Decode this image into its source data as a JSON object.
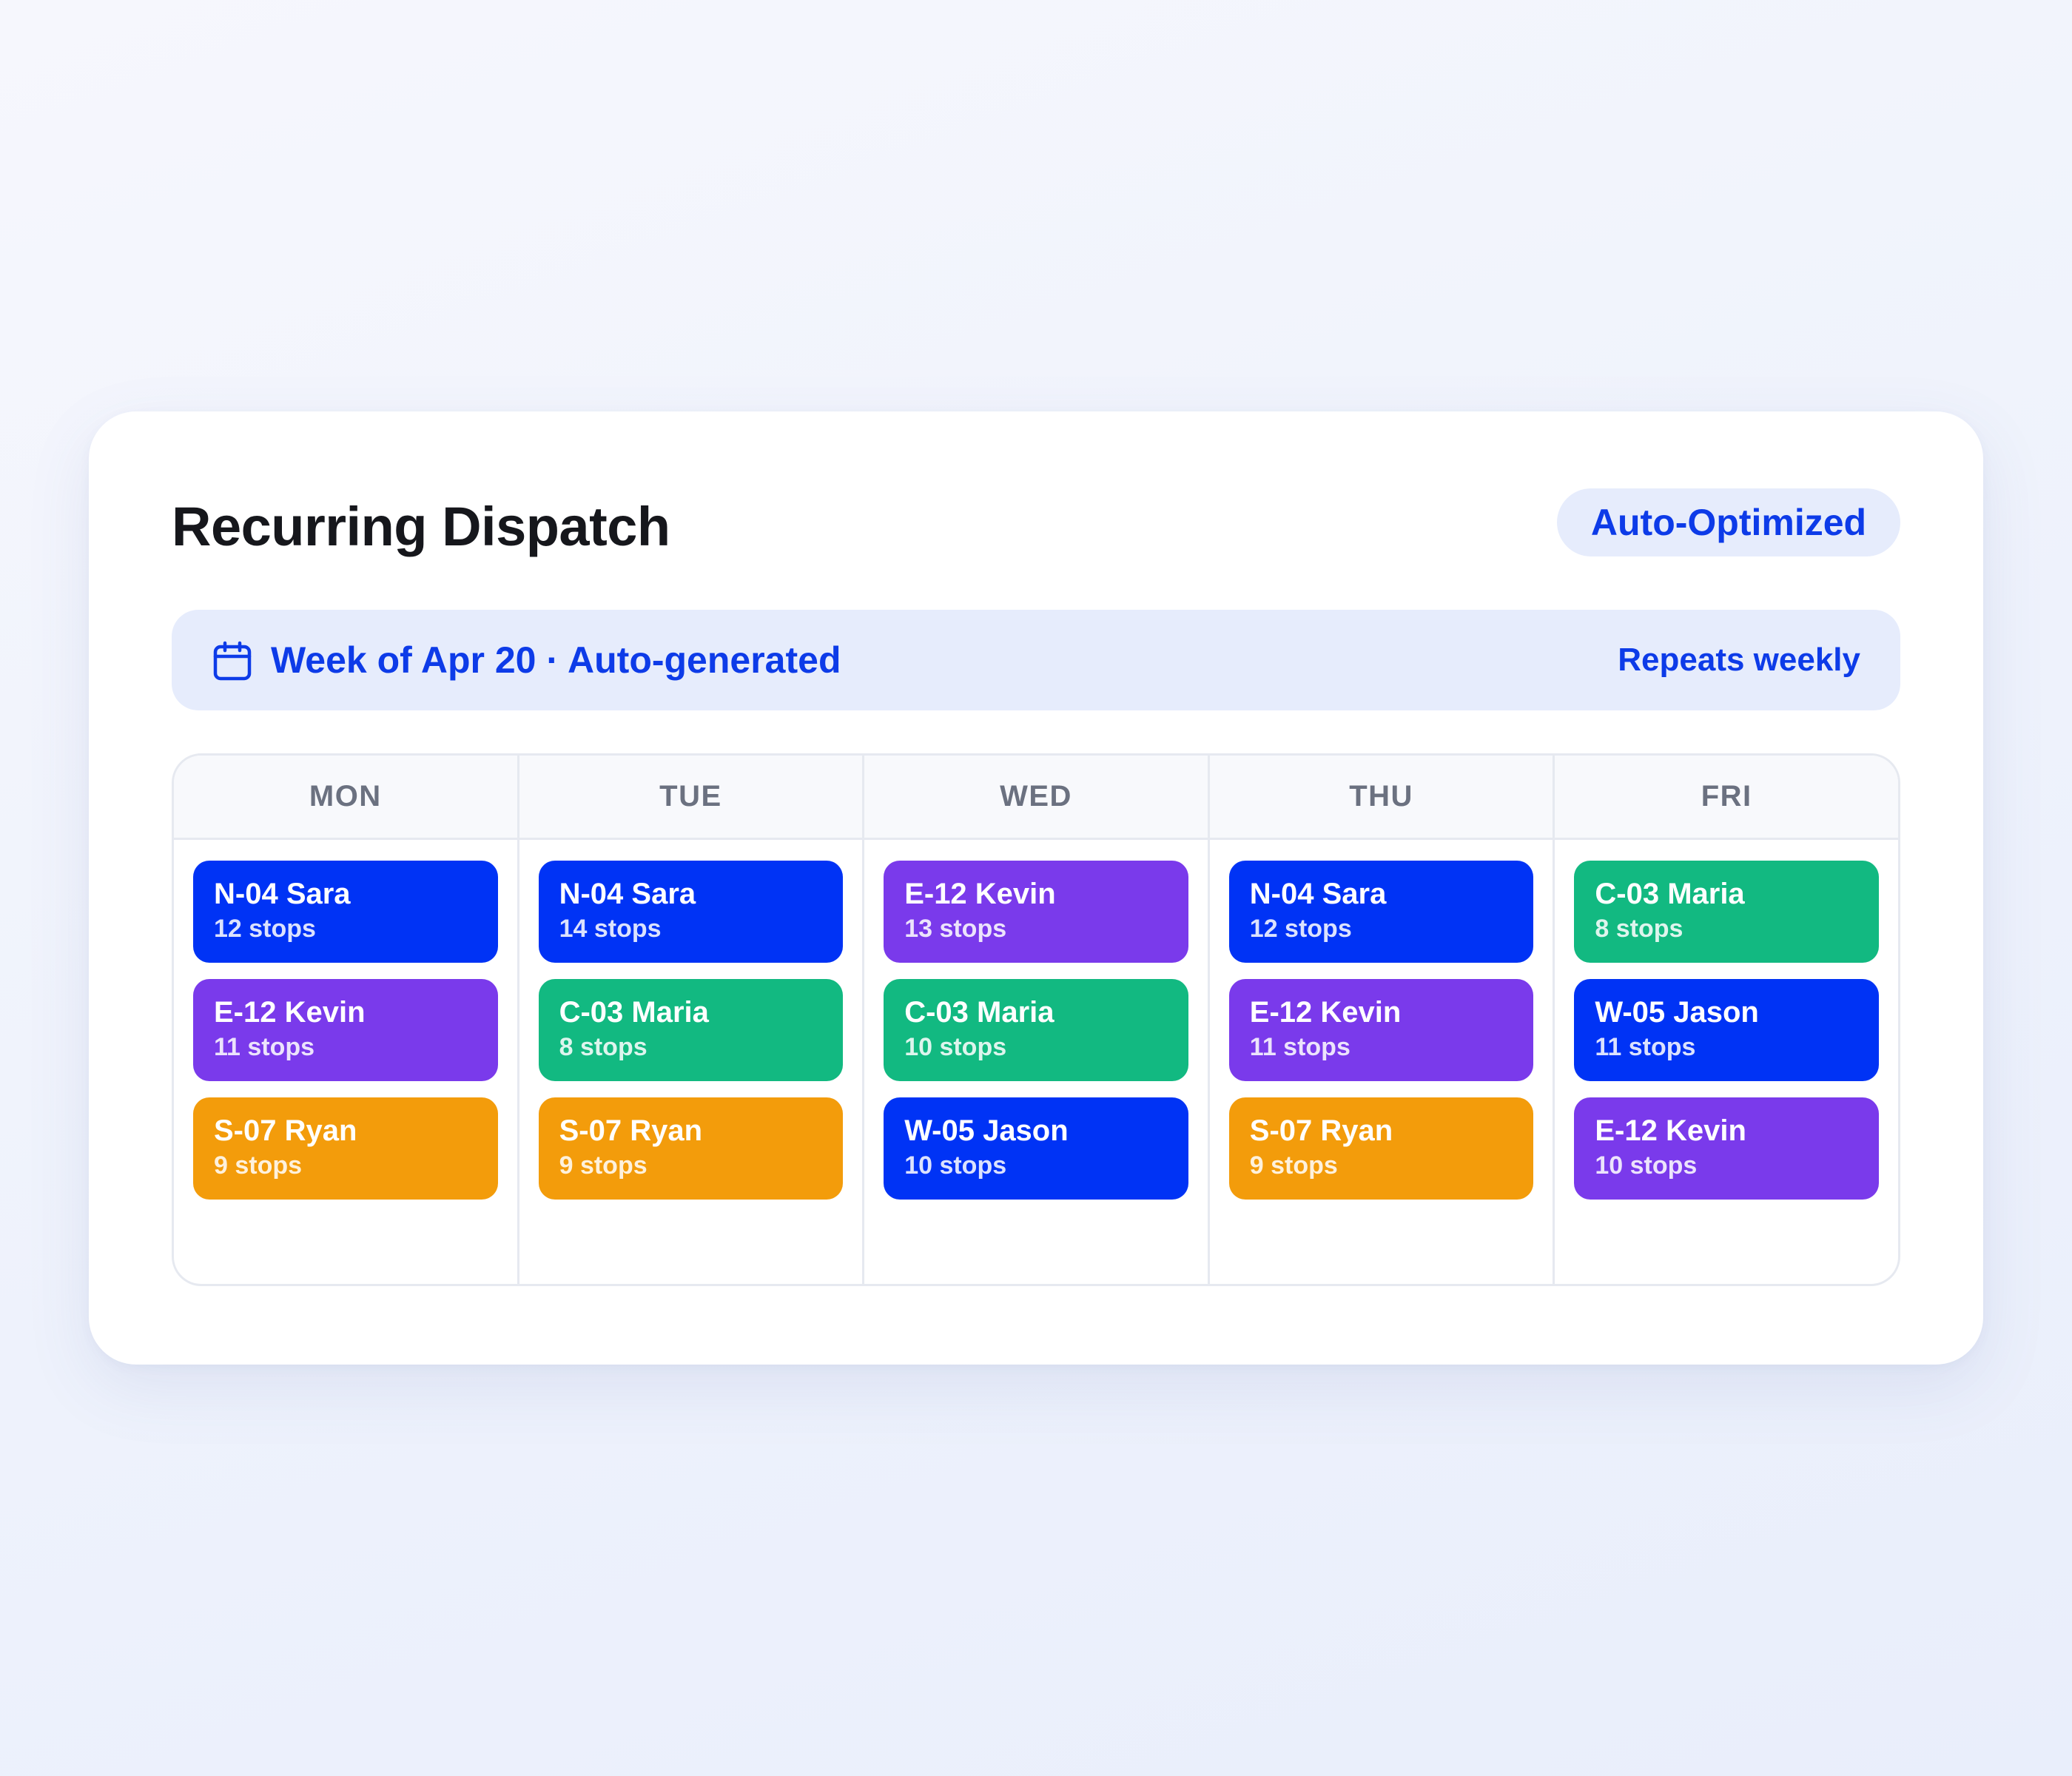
{
  "header": {
    "title": "Recurring Dispatch",
    "badge": "Auto-Optimized"
  },
  "banner": {
    "icon": "calendar-icon",
    "text": "Week of Apr 20 · Auto-generated",
    "right_text": "Repeats weekly"
  },
  "colors": {
    "accent": "#0d3be8",
    "route_blue": "#0033f5",
    "route_purple": "#7a3aeb",
    "route_green": "#12b981",
    "route_orange": "#f39c0b"
  },
  "schedule": [
    {
      "day": "MON",
      "routes": [
        {
          "name": "N-04 Sara",
          "stops": "12 stops",
          "color": "#0033f5"
        },
        {
          "name": "E-12 Kevin",
          "stops": "11 stops",
          "color": "#7a3aeb"
        },
        {
          "name": "S-07 Ryan",
          "stops": "9 stops",
          "color": "#f39c0b"
        }
      ]
    },
    {
      "day": "TUE",
      "routes": [
        {
          "name": "N-04 Sara",
          "stops": "14 stops",
          "color": "#0033f5"
        },
        {
          "name": "C-03 Maria",
          "stops": "8 stops",
          "color": "#12b981"
        },
        {
          "name": "S-07 Ryan",
          "stops": "9 stops",
          "color": "#f39c0b"
        }
      ]
    },
    {
      "day": "WED",
      "routes": [
        {
          "name": "E-12 Kevin",
          "stops": "13 stops",
          "color": "#7a3aeb"
        },
        {
          "name": "C-03 Maria",
          "stops": "10 stops",
          "color": "#12b981"
        },
        {
          "name": "W-05 Jason",
          "stops": "10 stops",
          "color": "#0033f5"
        }
      ]
    },
    {
      "day": "THU",
      "routes": [
        {
          "name": "N-04 Sara",
          "stops": "12 stops",
          "color": "#0033f5"
        },
        {
          "name": "E-12 Kevin",
          "stops": "11 stops",
          "color": "#7a3aeb"
        },
        {
          "name": "S-07 Ryan",
          "stops": "9 stops",
          "color": "#f39c0b"
        }
      ]
    },
    {
      "day": "FRI",
      "routes": [
        {
          "name": "C-03 Maria",
          "stops": "8 stops",
          "color": "#12b981"
        },
        {
          "name": "W-05 Jason",
          "stops": "11 stops",
          "color": "#0033f5"
        },
        {
          "name": "E-12 Kevin",
          "stops": "10 stops",
          "color": "#7a3aeb"
        }
      ]
    }
  ]
}
